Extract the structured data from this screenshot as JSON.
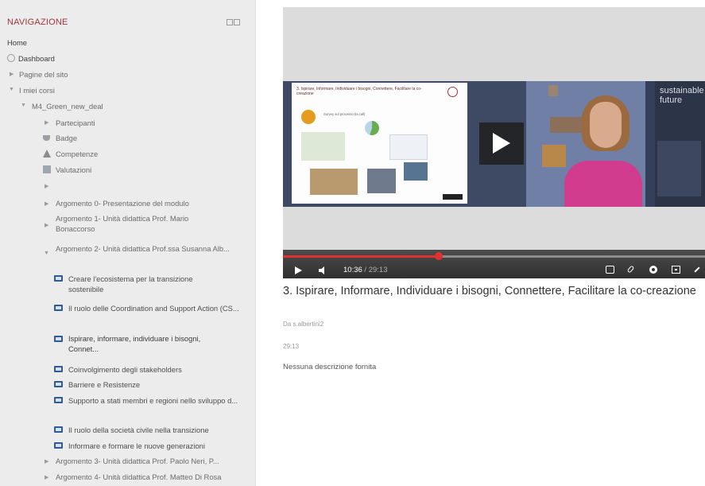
{
  "nav": {
    "title": "NAVIGAZIONE",
    "home": "Home",
    "dashboard": "Dashboard",
    "site_pages": "Pagine del sito",
    "my_courses": "I miei corsi",
    "course": "M4_Green_new_deal",
    "participants": "Partecipanti",
    "badges": "Badge",
    "competencies": "Competenze",
    "grades": "Valutazioni",
    "topics": [
      "Argomento 0- Presentazione del modulo",
      "Argomento 1- Unità didattica Prof. Mario Bonaccorso",
      "Argomento 2- Unità didattica Prof.ssa Susanna Alb...",
      "Argomento 3- Unità didattica Prof. Paolo Neri, P...",
      "Argomento 4- Unità didattica Prof. Matteo Di Rosa"
    ],
    "lessons": [
      "Creare l'ecosistema per la transizione sostenibile",
      "Il ruolo delle Coordination and Support Action (CS...",
      "Ispirare, informare, individuare i bisogni, Connet...",
      "Coinvolgimento degli stakeholders",
      "Barriere e Resistenze",
      "Supporto a stati membri e regioni nello sviluppo d...",
      "Il ruolo della società civile nella transizione",
      "Informare e formare le nuove generazioni"
    ]
  },
  "video": {
    "slide_title": "3. Ispirare, Informare, Individuare i bisogni, Connettere, Facilitare la co-creazione",
    "slide_subtitle": "Survey sul processo (la call)",
    "banner_text": "sustainable future",
    "current_time": "10:36",
    "total_time": "/ 29:13",
    "progress": 0.37
  },
  "content": {
    "title": "3. Ispirare, Informare, Individuare i bisogni, Connettere, Facilitare la co-creazione",
    "author": "Da s.albertini2",
    "duration": "29:13",
    "description": "Nessuna descrizione fornita"
  },
  "icons": [
    "dashboard-icon",
    "trophy-icon",
    "competency-icon",
    "grades-icon",
    "slide-icon",
    "play-icon",
    "volume-icon",
    "cc-icon",
    "clip-icon",
    "gear-icon",
    "pip-icon",
    "fullscreen-icon"
  ]
}
